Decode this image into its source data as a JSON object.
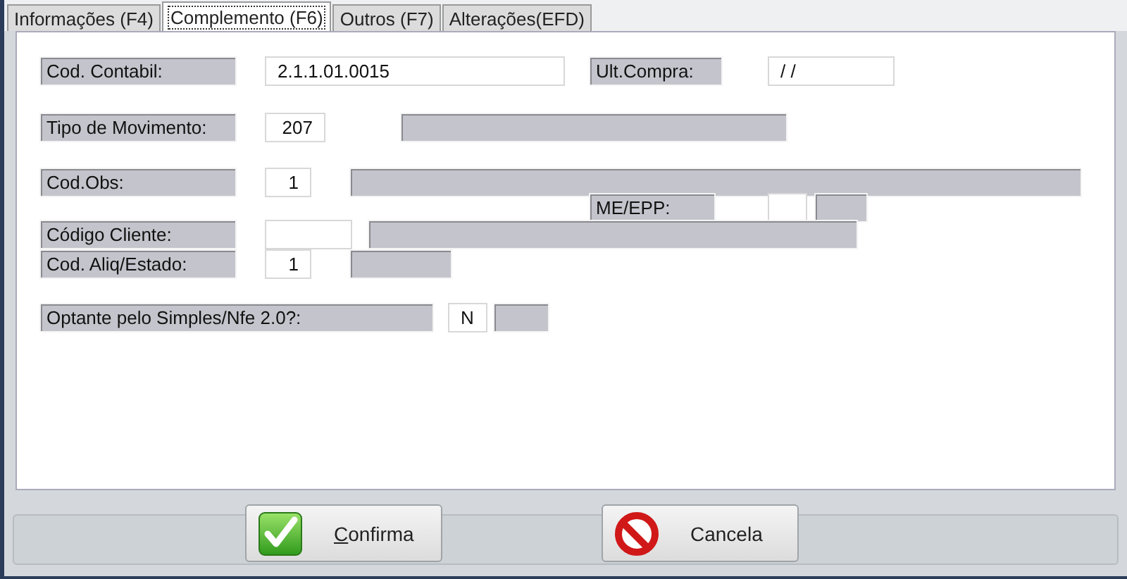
{
  "tabs": [
    {
      "label": "Informações (F4)",
      "selected": false
    },
    {
      "label": "Complemento (F6)",
      "selected": true
    },
    {
      "label": "Outros (F7)",
      "selected": false
    },
    {
      "label": "Alterações(EFD)",
      "selected": false
    }
  ],
  "form": {
    "cod_contabil": {
      "label": "Cod. Contabil:",
      "value": "2.1.1.01.0015"
    },
    "ult_compra": {
      "label": "Ult.Compra:",
      "value": "/ /"
    },
    "tipo_movimento": {
      "label": "Tipo de Movimento:",
      "value": "207"
    },
    "cod_obs": {
      "label": "Cod.Obs:",
      "value": "1"
    },
    "me_epp": {
      "label": "ME/EPP:"
    },
    "codigo_cliente": {
      "label": "Código Cliente:"
    },
    "cod_aliq_estado": {
      "label": "Cod. Aliq/Estado:",
      "value": "1"
    },
    "optante_simples": {
      "label": "Optante pelo Simples/Nfe 2.0?:",
      "value": "N"
    }
  },
  "buttons": [
    {
      "label": "Confirma",
      "kind": "confirm",
      "underline_first": true
    },
    {
      "label": "Cancela",
      "kind": "cancel"
    }
  ]
}
